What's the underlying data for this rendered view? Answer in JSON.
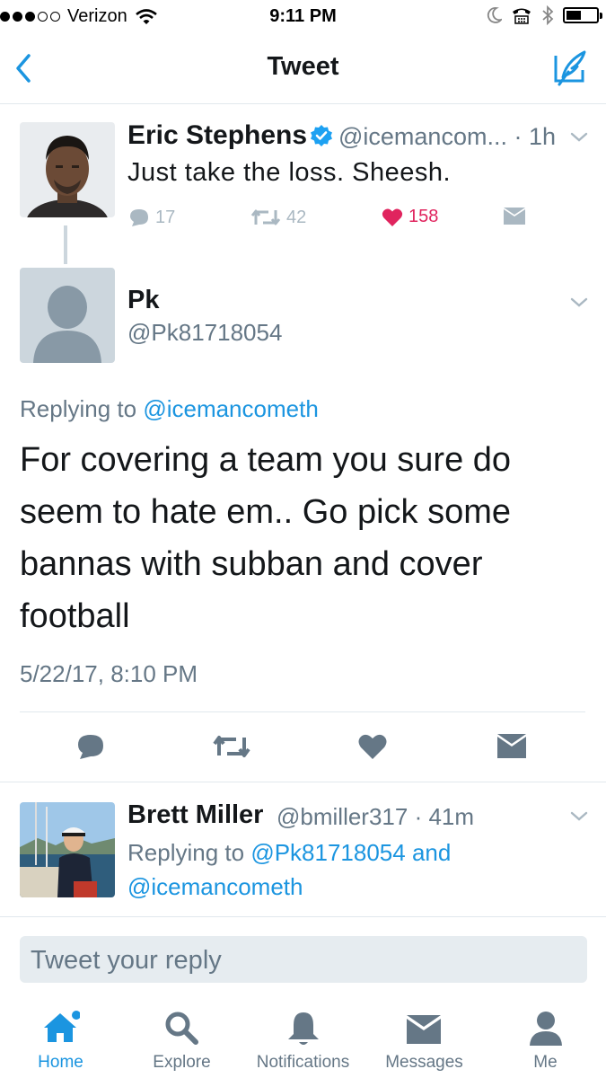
{
  "status_bar": {
    "carrier": "Verizon",
    "time": "9:11 PM",
    "signal_dots_filled": 3,
    "signal_dots_total": 5
  },
  "nav": {
    "title": "Tweet"
  },
  "parent_tweet": {
    "name": "Eric Stephens",
    "verified": true,
    "meta": "@icemancom... · 1h",
    "text": "Just take the loss. Sheesh.",
    "replies": "17",
    "retweets": "42",
    "likes": "158",
    "liked": true
  },
  "main_tweet": {
    "name": "Pk",
    "handle": "@Pk81718054",
    "replying_prefix": "Replying to",
    "replying_to": "@icemancometh",
    "text": "For covering a team you sure do seem to hate em.. Go pick some bannas with subban and cover football",
    "timestamp": "5/22/17, 8:10 PM"
  },
  "reply_tweet": {
    "name": "Brett Miller",
    "meta": "@bmiller317 · 41m",
    "replying_prefix": "Replying to",
    "replying_to_1": "@Pk81718054",
    "and_word": "and",
    "replying_to_2": "@icemancometh"
  },
  "reply_box": {
    "placeholder": "Tweet your reply"
  },
  "tabs": [
    {
      "label": "Home",
      "icon": "home-icon",
      "active": true
    },
    {
      "label": "Explore",
      "icon": "search-icon",
      "active": false
    },
    {
      "label": "Notifications",
      "icon": "bell-icon",
      "active": false
    },
    {
      "label": "Messages",
      "icon": "envelope-icon",
      "active": false
    },
    {
      "label": "Me",
      "icon": "person-icon",
      "active": false
    }
  ],
  "colors": {
    "accent": "#1b95e0",
    "like": "#e0245e",
    "secondary_text": "#657786",
    "action_gray": "#aab8c2"
  }
}
